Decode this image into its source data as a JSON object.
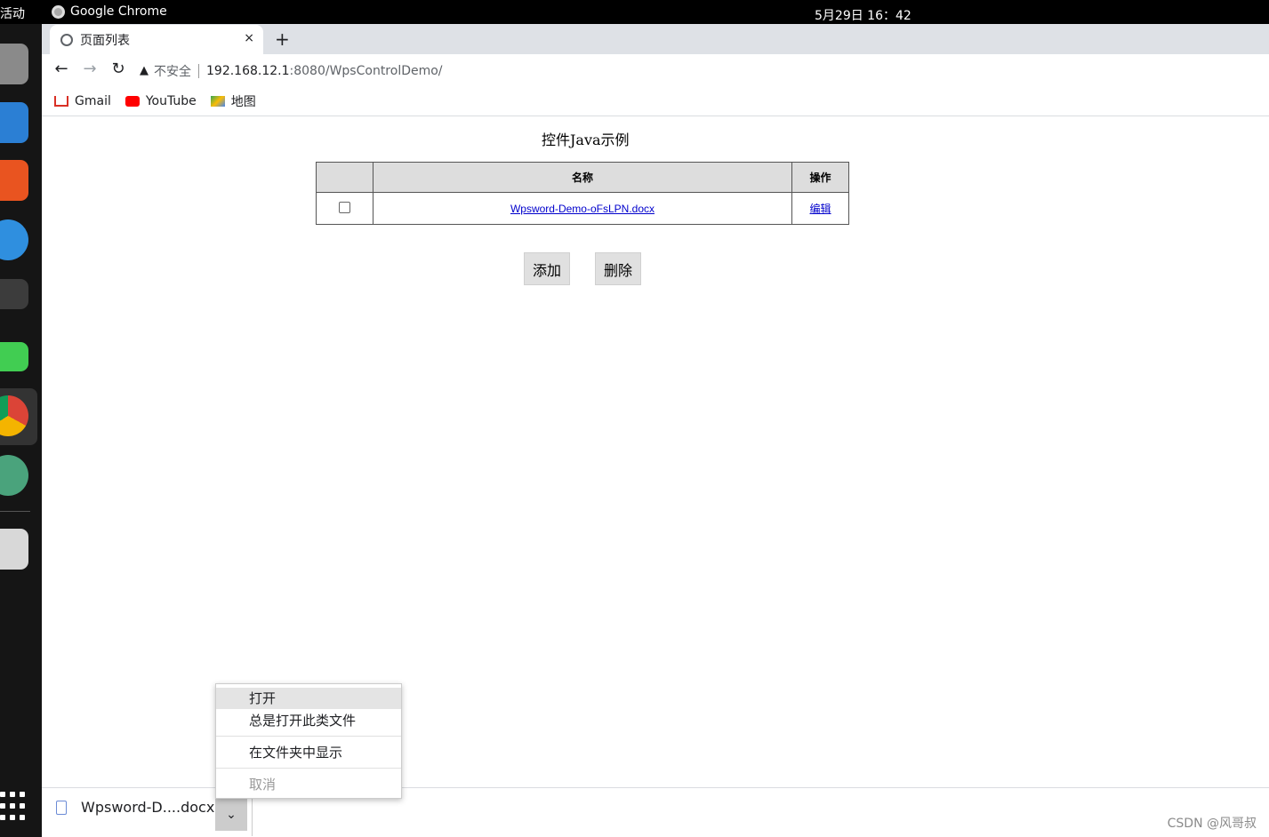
{
  "system": {
    "activities": "活动",
    "app_name": "Google Chrome",
    "clock": "5月29日  16：42"
  },
  "dock": {
    "icons": [
      "files-icon",
      "writer-icon",
      "software-center-icon",
      "help-icon",
      "terminal-icon",
      "qtcreator-icon",
      "chrome-icon",
      "atom-icon",
      "trash-icon",
      "show-apps-icon"
    ]
  },
  "browser": {
    "tab": {
      "title": "页面列表",
      "close": "×"
    },
    "new_tab": "+",
    "nav": {
      "back": "←",
      "forward": "→",
      "reload": "↻"
    },
    "address": {
      "security_label": "不安全",
      "host": "192.168.12.1",
      "path": ":8080/WpsControlDemo/"
    },
    "bookmarks": [
      {
        "label": "Gmail",
        "icon": "gmail-icon"
      },
      {
        "label": "YouTube",
        "icon": "youtube-icon"
      },
      {
        "label": "地图",
        "icon": "maps-icon"
      }
    ]
  },
  "page": {
    "title": "控件Java示例",
    "table": {
      "headers": [
        "",
        "名称",
        "操作"
      ],
      "rows": [
        {
          "name": "Wpsword-Demo-oFsLPN.docx",
          "action": "编辑"
        }
      ]
    },
    "buttons": {
      "add": "添加",
      "delete": "删除"
    }
  },
  "downloads": {
    "file_label": "Wpsword-D....docx",
    "chevron": "⌄",
    "watermark": "CSDN @风哥叔"
  },
  "context_menu": {
    "items": [
      "打开",
      "总是打开此类文件",
      "在文件夹中显示",
      "取消"
    ]
  }
}
